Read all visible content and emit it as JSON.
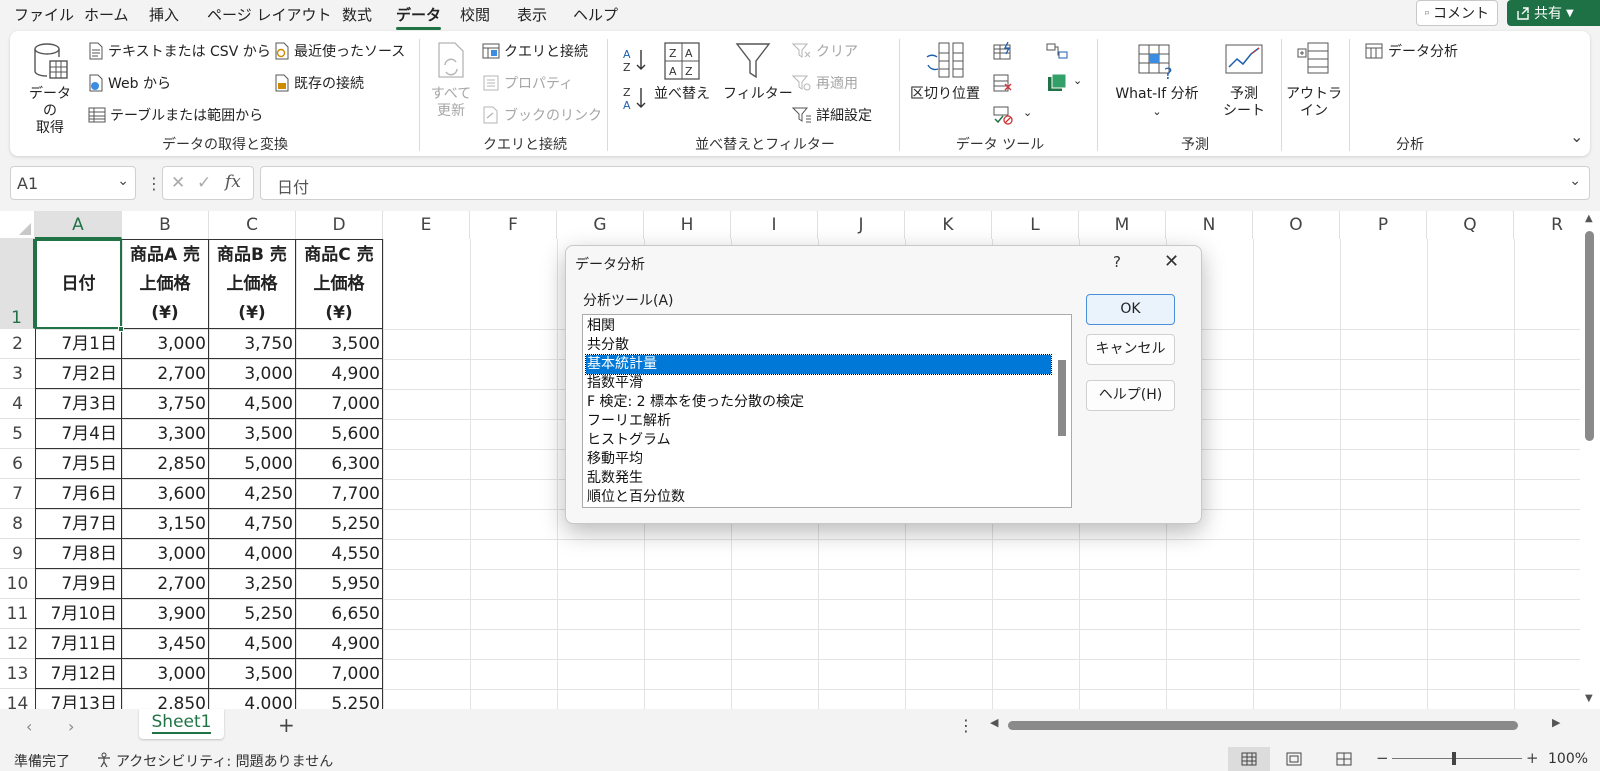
{
  "menu": {
    "tabs": [
      "ファイル",
      "ホーム",
      "挿入",
      "ページ レイアウト",
      "数式",
      "データ",
      "校閲",
      "表示",
      "ヘルプ"
    ],
    "active": "データ",
    "comment_label": "コメント",
    "share_label": "共有"
  },
  "ribbon": {
    "get_data": "データの\n取得",
    "text_csv": "テキストまたは CSV から",
    "web": "Web から",
    "table_range": "テーブルまたは範囲から",
    "recent_sources": "最近使ったソース",
    "existing_conn": "既存の接続",
    "group1": "データの取得と変換",
    "refresh_all": "すべて\n更新",
    "queries_conn": "クエリと接続",
    "properties": "プロパティ",
    "edit_links": "ブックのリンク",
    "group2": "クエリと接続",
    "sort": "並べ替え",
    "filter": "フィルター",
    "clear": "クリア",
    "reapply": "再適用",
    "advanced": "詳細設定",
    "group3": "並べ替えとフィルター",
    "text_to_cols": "区切り位置",
    "group4": "データ ツール",
    "whatif": "What-If 分析",
    "forecast": "予測\nシート",
    "group5": "予測",
    "outline": "アウトラ\nイン",
    "data_analysis": "データ分析",
    "group6": "分析"
  },
  "formula_bar": {
    "name_box": "A1",
    "formula": "日付",
    "fx": "fx"
  },
  "grid": {
    "columns": [
      "A",
      "B",
      "C",
      "D",
      "E",
      "F",
      "G",
      "H",
      "I",
      "J",
      "K",
      "L",
      "M",
      "N",
      "O",
      "P",
      "Q",
      "R"
    ],
    "header_row": [
      "日付",
      "商品A 売\n上価格\n(¥)",
      "商品B 売\n上価格\n(¥)",
      "商品C 売\n上価格\n(¥)"
    ],
    "rows": [
      [
        "7月1日",
        "3,000",
        "3,750",
        "3,500"
      ],
      [
        "7月2日",
        "2,700",
        "3,000",
        "4,900"
      ],
      [
        "7月3日",
        "3,750",
        "4,500",
        "7,000"
      ],
      [
        "7月4日",
        "3,300",
        "3,500",
        "5,600"
      ],
      [
        "7月5日",
        "2,850",
        "5,000",
        "6,300"
      ],
      [
        "7月6日",
        "3,600",
        "4,250",
        "7,700"
      ],
      [
        "7月7日",
        "3,150",
        "4,750",
        "5,250"
      ],
      [
        "7月8日",
        "3,000",
        "4,000",
        "4,550"
      ],
      [
        "7月9日",
        "2,700",
        "3,250",
        "5,950"
      ],
      [
        "7月10日",
        "3,900",
        "5,250",
        "6,650"
      ],
      [
        "7月11日",
        "3,450",
        "4,500",
        "4,900"
      ],
      [
        "7月12日",
        "3,000",
        "3,500",
        "7,000"
      ],
      [
        "7月13日",
        "2,850",
        "4,000",
        "5,250"
      ]
    ]
  },
  "dialog": {
    "title": "データ分析",
    "help_glyph": "?",
    "list_label": "分析ツール(A)",
    "items": [
      "相関",
      "共分散",
      "基本統計量",
      "指数平滑",
      "F 検定: 2 標本を使った分散の検定",
      "フーリエ解析",
      "ヒストグラム",
      "移動平均",
      "乱数発生",
      "順位と百分位数"
    ],
    "selected_index": 2,
    "ok": "OK",
    "cancel": "キャンセル",
    "help": "ヘルプ(H)"
  },
  "sheets": {
    "tabs": [
      "Sheet1"
    ],
    "add": "+"
  },
  "status": {
    "ready": "準備完了",
    "accessibility": "アクセシビリティ: 問題ありません",
    "zoom": "100%"
  },
  "colors": {
    "accent": "#217346",
    "selection": "#0078d7"
  }
}
